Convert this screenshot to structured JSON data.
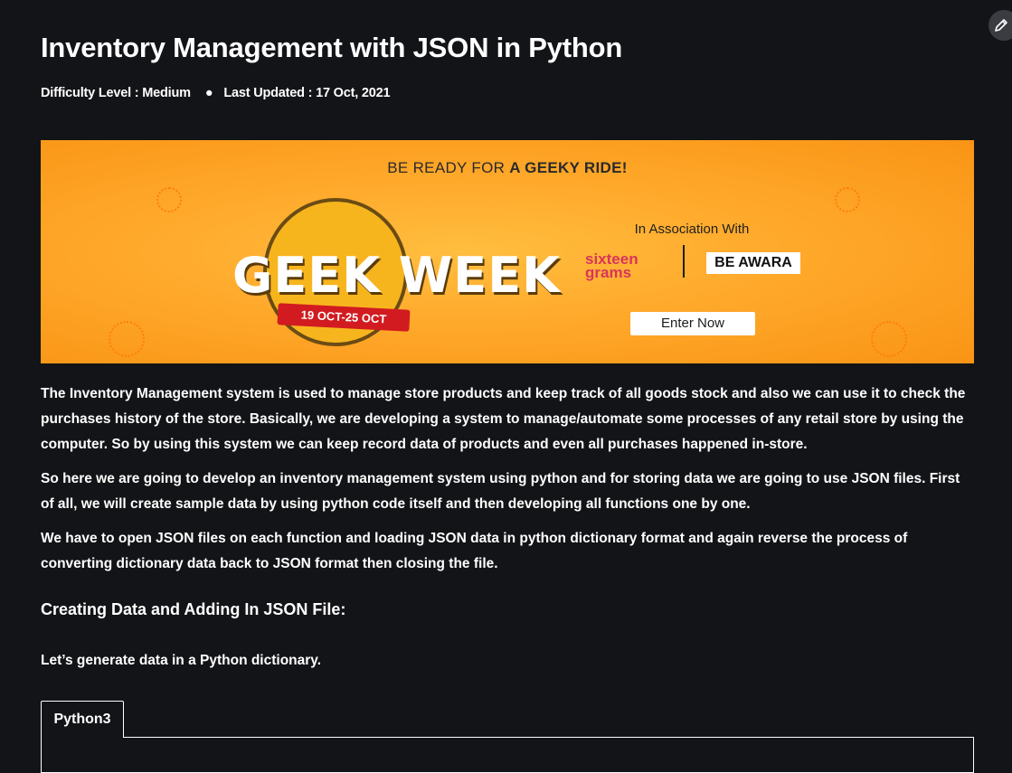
{
  "article": {
    "title": "Inventory Management with JSON in Python",
    "difficulty": "Difficulty Level : Medium",
    "separator": "●",
    "last_updated": "Last Updated : 17 Oct, 2021"
  },
  "banner": {
    "headline_regular": "BE READY FOR ",
    "headline_bold": "A GEEKY RIDE!",
    "geek_week_text": "GEEK WEEK",
    "dates": "19 OCT-25 OCT",
    "association_label": "In Association With",
    "partner_1": "sixteen grams",
    "partner_2": "BE AWARA",
    "cta_label": "Enter Now"
  },
  "body": {
    "paragraph_1": "The Inventory Management system is used to manage store products and keep track of all goods stock and also we can use it to check the purchases history of the store. Basically, we are developing a system to manage/automate some processes of any retail store by using the computer. So by using this system we can keep record data of products and even all purchases happened in-store.",
    "paragraph_2": "So here we are going to develop an inventory management system using python and for storing data we are going to use JSON files. First of all, we will create sample data by using python code itself and then developing all functions one by one.",
    "paragraph_3": "We have to open JSON files on each function and loading JSON data in python dictionary format and again reverse the process of converting dictionary data back to JSON format then closing the file.",
    "section_heading": "Creating Data and Adding In JSON File:",
    "paragraph_4": "Let’s generate data in a Python dictionary."
  },
  "code": {
    "tab_label": "Python3"
  },
  "icons": {
    "edit": "pencil-icon"
  },
  "colors": {
    "background": "#131417",
    "banner_orange": "#ffa92b",
    "ribbon_red": "#d11b20"
  }
}
